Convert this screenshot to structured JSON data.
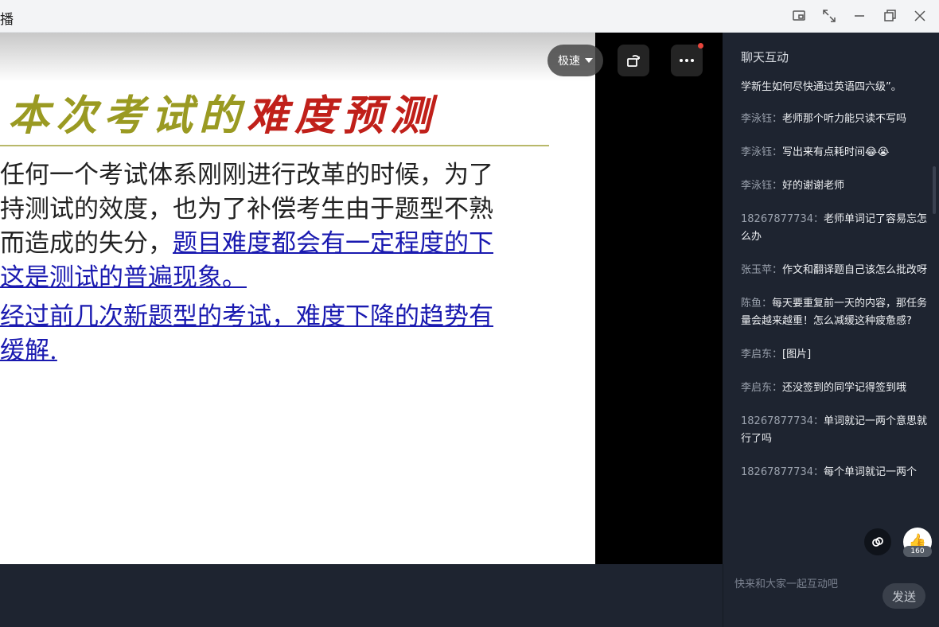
{
  "window": {
    "title": "播"
  },
  "slide": {
    "title_part1": "本次考试的",
    "title_part2": "难度预测",
    "lines": [
      {
        "text": "任何一个考试体系刚刚进行改革的时候，为了",
        "link": ""
      },
      {
        "text": "持测试的效度，也为了补偿考生由于题型不熟",
        "link": ""
      },
      {
        "text": "而造成的失分，",
        "link": "题目难度都会有一定程度的下"
      },
      {
        "text": "",
        "link": "这是测试的普遍现象。"
      },
      {
        "text": "",
        "link": "经过前几次新题型的考试，难度下降的趋势有"
      },
      {
        "text": "",
        "link": "缓解."
      }
    ]
  },
  "player": {
    "speed_label": "极速"
  },
  "chat": {
    "header": "聊天互动",
    "messages": [
      {
        "name": "",
        "text": "学新生如何尽快通过英语四六级”。"
      },
      {
        "name": "李泳钰：",
        "text": "老师那个听力能只读不写吗"
      },
      {
        "name": "李泳钰：",
        "text": "写出来有点耗时间😂😭"
      },
      {
        "name": "李泳钰：",
        "text": "好的谢谢老师"
      },
      {
        "name": "18267877734：",
        "text": "老师单词记了容易忘怎么办"
      },
      {
        "name": "张玉苹：",
        "text": "作文和翻译题自己该怎么批改呀"
      },
      {
        "name": "陈鱼：",
        "text": "每天要重复前一天的内容，那任务量会越来越重！怎么减缓这种疲惫感?"
      },
      {
        "name": "李启东：",
        "text": "[图片]"
      },
      {
        "name": "李启东：",
        "text": "还没签到的同学记得签到哦"
      },
      {
        "name": "18267877734：",
        "text": "单词就记一两个意思就行了吗"
      },
      {
        "name": "18267877734：",
        "text": "每个单词就记一两个"
      }
    ],
    "like_count": "160",
    "input_placeholder": "快来和大家一起互动吧",
    "send_label": "发送"
  },
  "icons": {
    "minimize": "minimize-icon",
    "restore": "restore-icon",
    "close": "close-icon",
    "expand": "expand-icon",
    "pip": "pip-icon",
    "rotate": "rotate-icon",
    "more": "more-icon",
    "link": "link-icon",
    "thumb": "thumbs-up-icon"
  },
  "colors": {
    "title_olive": "#9a9a22",
    "title_red": "#c0201a",
    "link_blue": "#1a1ab0",
    "panel_bg": "#1e2430"
  }
}
